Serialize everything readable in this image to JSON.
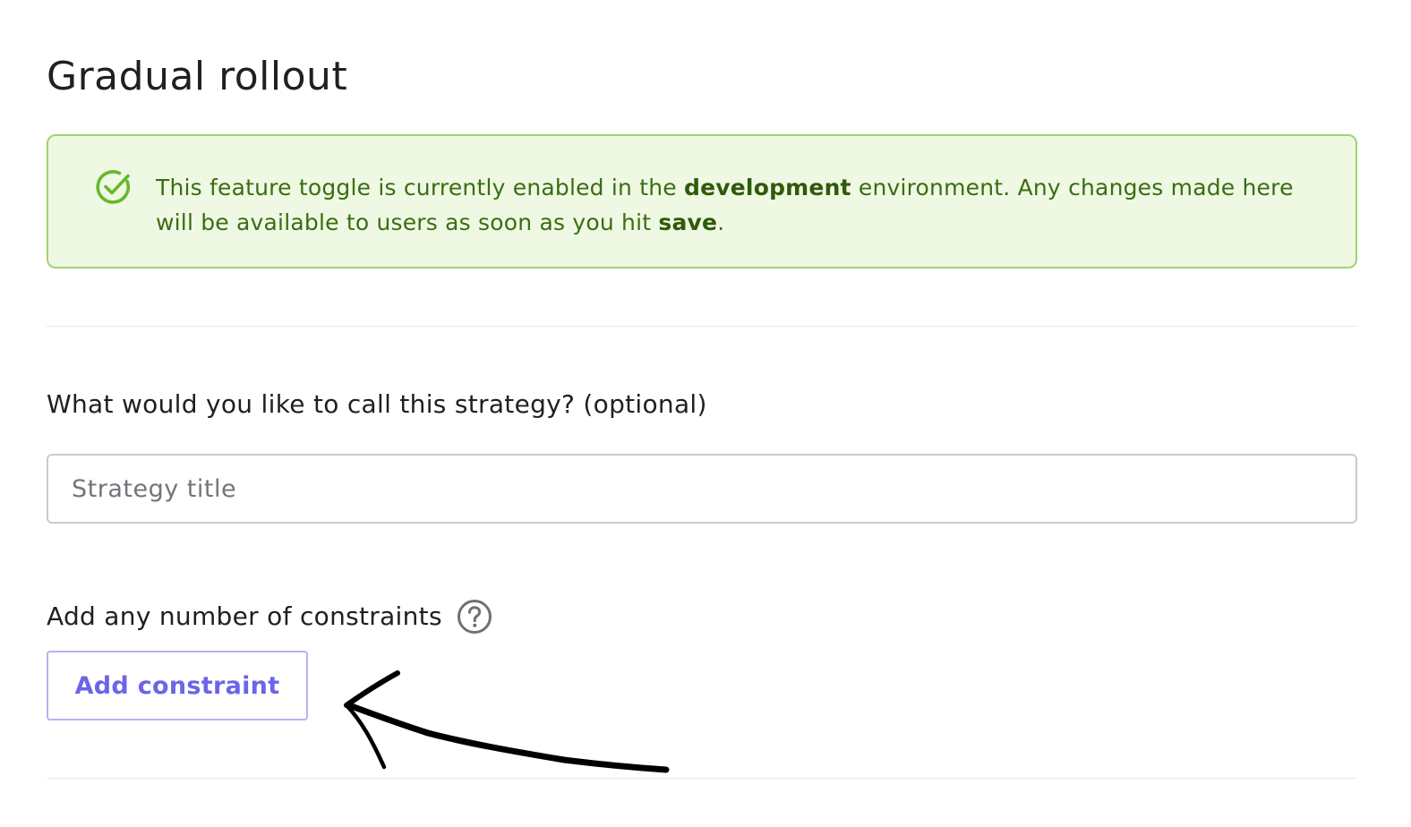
{
  "page": {
    "title": "Gradual rollout"
  },
  "alert": {
    "icon": "check-circle-icon",
    "text_part1": "This feature toggle is currently enabled in the ",
    "environment": "development",
    "text_part2": " environment. Any changes made here will be available to users as soon as you hit ",
    "action": "save",
    "text_part3": ".",
    "colors": {
      "background": "#eef8e3",
      "border": "#9fd472",
      "text": "#3b6d12"
    }
  },
  "strategy_name": {
    "label": "What would you like to call this strategy? (optional)",
    "placeholder": "Strategy title",
    "value": ""
  },
  "constraints": {
    "label": "Add any number of constraints",
    "help_icon": "help-circle-icon",
    "add_button_label": "Add constraint",
    "accent_color": "#6c65e5"
  },
  "annotation": {
    "icon": "hand-drawn-arrow-icon"
  }
}
